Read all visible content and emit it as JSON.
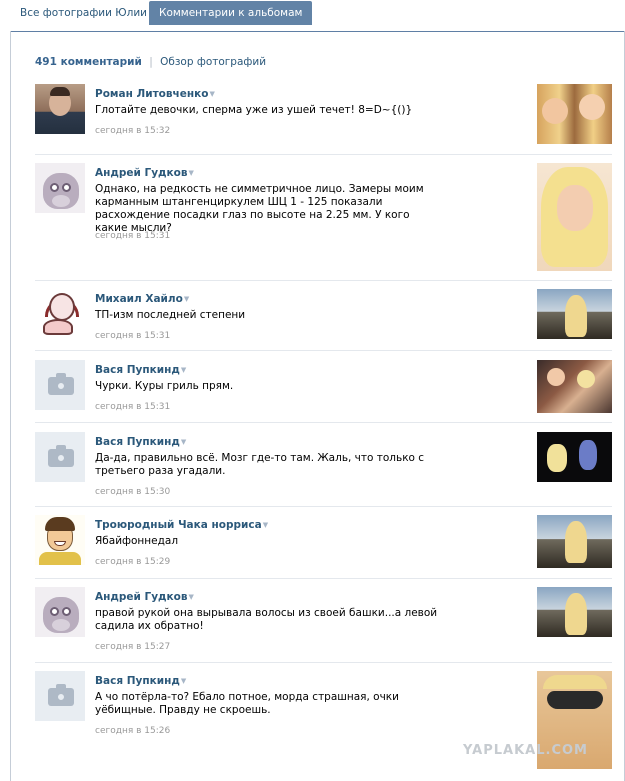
{
  "tabs": [
    {
      "label": "Все фотографии Юлии",
      "active": false
    },
    {
      "label": "Комментарии к альбомам",
      "active": true
    }
  ],
  "summary": {
    "count": "491 комментарий",
    "separator": "|",
    "photos_link": "Обзор фотографий"
  },
  "comments": [
    {
      "author": "Роман Литовченко",
      "text": "Глотайте девочки, сперма уже из ушей течет! 8=D~{()}",
      "time": "сегодня в 15:32",
      "avatar": "photo-portrait",
      "photo": "two-girls-photo"
    },
    {
      "author": "Андрей Гудков",
      "text": "Однако, на редкость не симметричное лицо. Замеры моим карманным штангенциркулем ШЦ 1 - 125 показали расхождение посадки глаз по высоте на 2.25 мм. У кого какие мысли?",
      "time": "сегодня в 15:31",
      "avatar": "owl-drawing",
      "photo": "blonde-closeup-photo"
    },
    {
      "author": "Михаил Хайло",
      "text": "ТП-изм последней степени",
      "time": "сегодня в 15:31",
      "avatar": "headphones-sketch",
      "photo": "seaside-photo"
    },
    {
      "author": "Вася Пупкинд",
      "text": "Чурки. Куры гриль прям.",
      "time": "сегодня в 15:31",
      "avatar": "camera-placeholder",
      "photo": "party-photo"
    },
    {
      "author": "Вася Пупкинд",
      "text": "Да-да, правильно всё. Мозг где-то там. Жаль, что только с третьего раза угадали.",
      "time": "сегодня в 15:30",
      "avatar": "camera-placeholder",
      "photo": "club-photo"
    },
    {
      "author": "Троюродный Чака норриса",
      "text": "Ябайфоннедал",
      "time": "сегодня в 15:29",
      "avatar": "cartoon-face",
      "photo": "seaside-photo"
    },
    {
      "author": "Андрей Гудков",
      "text": "правой рукой она вырывала волосы из своей башки...а левой садила их обратно!",
      "time": "сегодня в 15:27",
      "avatar": "owl-drawing",
      "photo": "seaside-photo"
    },
    {
      "author": "Вася Пупкинд",
      "text": "А чо потёрла-то? Ебало потное, морда страшная, очки уёбищные. Правду не скроешь.",
      "time": "сегодня в 15:26",
      "avatar": "camera-placeholder",
      "photo": "sunglasses-photo"
    }
  ],
  "menu_arrow": "▼",
  "watermark": "YAPLAKAL.COM",
  "colors": {
    "link": "#2b587a",
    "tab_active_bg": "#6283a6",
    "time": "#999999"
  }
}
